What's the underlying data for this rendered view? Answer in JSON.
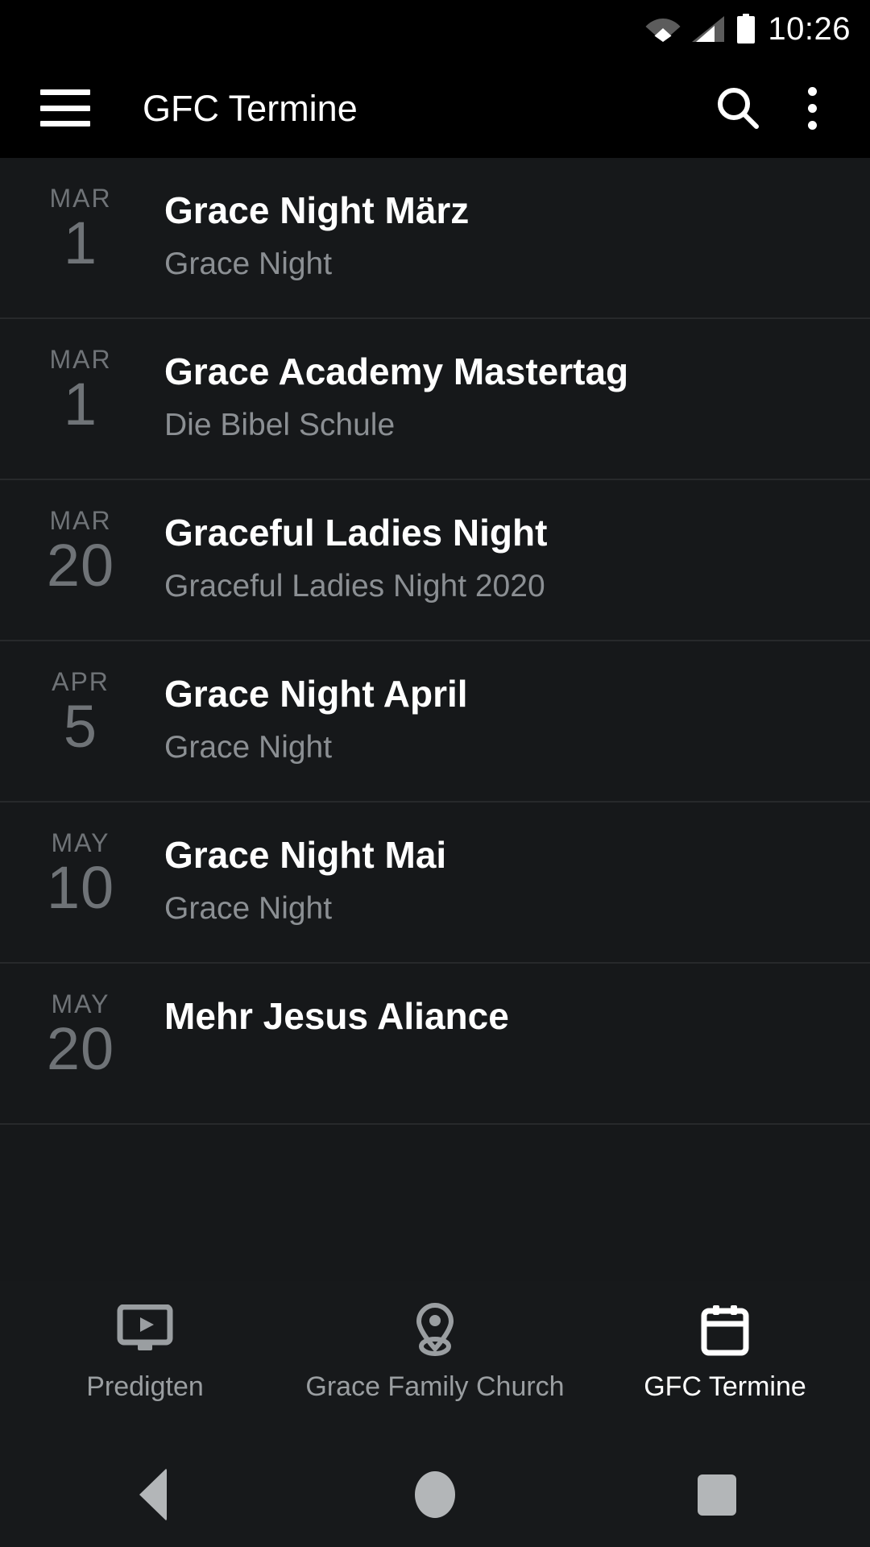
{
  "status_bar": {
    "time": "10:26",
    "icons": [
      "wifi-icon",
      "cell-signal-icon",
      "battery-icon"
    ]
  },
  "toolbar": {
    "menu_icon": "hamburger-menu-icon",
    "title": "GFC Termine",
    "search_icon": "search-icon",
    "overflow_icon": "overflow-menu-icon"
  },
  "events": [
    {
      "month": "MAR",
      "day": "1",
      "title": "Grace Night März",
      "subtitle": "Grace Night"
    },
    {
      "month": "MAR",
      "day": "1",
      "title": "Grace Academy Mastertag",
      "subtitle": "Die Bibel Schule"
    },
    {
      "month": "MAR",
      "day": "20",
      "title": "Graceful Ladies Night",
      "subtitle": "Graceful Ladies Night 2020"
    },
    {
      "month": "APR",
      "day": "5",
      "title": "Grace Night April",
      "subtitle": "Grace Night"
    },
    {
      "month": "MAY",
      "day": "10",
      "title": "Grace Night Mai",
      "subtitle": "Grace Night"
    },
    {
      "month": "MAY",
      "day": "20",
      "title": "Mehr Jesus Aliance",
      "subtitle": ""
    }
  ],
  "bottom_nav": {
    "tabs": [
      {
        "label": "Predigten",
        "icon": "video-monitor-icon",
        "active": false
      },
      {
        "label": "Grace Family Church",
        "icon": "location-pin-icon",
        "active": false
      },
      {
        "label": "GFC Termine",
        "icon": "calendar-icon",
        "active": true
      }
    ]
  },
  "android_nav": {
    "back_label": "back-button",
    "home_label": "home-button",
    "recents_label": "recents-button"
  },
  "colors": {
    "bar_background": "#000000",
    "list_background": "#16181a",
    "divider": "#27292b",
    "title_text": "#ffffff",
    "subtitle_text": "#8b8f93",
    "date_text": "#6f7377",
    "nav_inactive": "#9a9ea1",
    "nav_active": "#ffffff"
  }
}
